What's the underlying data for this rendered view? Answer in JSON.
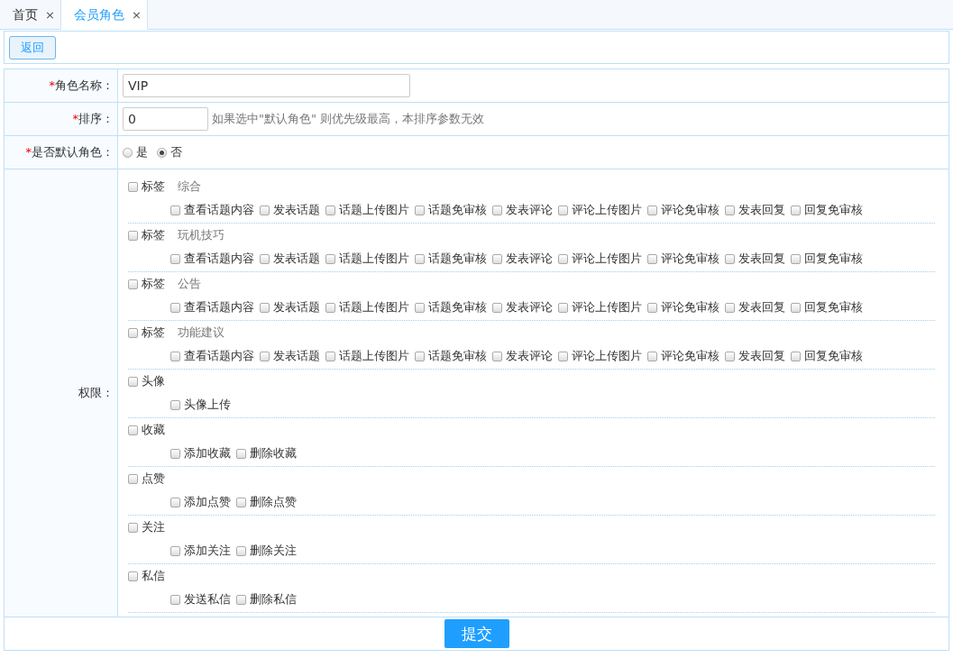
{
  "tabs": [
    {
      "label": "首页",
      "close": "×",
      "selected": false
    },
    {
      "label": "会员角色",
      "close": "×",
      "selected": true
    }
  ],
  "back_button": "返回",
  "fields": [
    {
      "kind": "text",
      "required_mark": "*",
      "label": "角色名称：",
      "value": "VIP",
      "wide": true
    },
    {
      "kind": "text",
      "required_mark": "*",
      "label": "排序：",
      "value": "0",
      "wide": false,
      "hint": "如果选中\"默认角色\" 则优先级最高，本排序参数无效"
    },
    {
      "kind": "radio",
      "required_mark": "*",
      "label": "是否默认角色：",
      "options": [
        {
          "label": "是",
          "selected": false
        },
        {
          "label": "否",
          "selected": true
        }
      ]
    }
  ],
  "permissions": {
    "label": "权限：",
    "groups": [
      {
        "label": "标签",
        "tag": "综合",
        "checked": false,
        "children": [
          {
            "label": "查看话题内容",
            "checked": false
          },
          {
            "label": "发表话题",
            "checked": false
          },
          {
            "label": "话题上传图片",
            "checked": false
          },
          {
            "label": "话题免审核",
            "checked": false
          },
          {
            "label": "发表评论",
            "checked": false
          },
          {
            "label": "评论上传图片",
            "checked": false
          },
          {
            "label": "评论免审核",
            "checked": false
          },
          {
            "label": "发表回复",
            "checked": false
          },
          {
            "label": "回复免审核",
            "checked": false
          }
        ]
      },
      {
        "label": "标签",
        "tag": "玩机技巧",
        "checked": false,
        "children": [
          {
            "label": "查看话题内容",
            "checked": false
          },
          {
            "label": "发表话题",
            "checked": false
          },
          {
            "label": "话题上传图片",
            "checked": false
          },
          {
            "label": "话题免审核",
            "checked": false
          },
          {
            "label": "发表评论",
            "checked": false
          },
          {
            "label": "评论上传图片",
            "checked": false
          },
          {
            "label": "评论免审核",
            "checked": false
          },
          {
            "label": "发表回复",
            "checked": false
          },
          {
            "label": "回复免审核",
            "checked": false
          }
        ]
      },
      {
        "label": "标签",
        "tag": "公告",
        "checked": false,
        "children": [
          {
            "label": "查看话题内容",
            "checked": false
          },
          {
            "label": "发表话题",
            "checked": false
          },
          {
            "label": "话题上传图片",
            "checked": false
          },
          {
            "label": "话题免审核",
            "checked": false
          },
          {
            "label": "发表评论",
            "checked": false
          },
          {
            "label": "评论上传图片",
            "checked": false
          },
          {
            "label": "评论免审核",
            "checked": false
          },
          {
            "label": "发表回复",
            "checked": false
          },
          {
            "label": "回复免审核",
            "checked": false
          }
        ]
      },
      {
        "label": "标签",
        "tag": "功能建议",
        "checked": false,
        "children": [
          {
            "label": "查看话题内容",
            "checked": false
          },
          {
            "label": "发表话题",
            "checked": false
          },
          {
            "label": "话题上传图片",
            "checked": false
          },
          {
            "label": "话题免审核",
            "checked": false
          },
          {
            "label": "发表评论",
            "checked": false
          },
          {
            "label": "评论上传图片",
            "checked": false
          },
          {
            "label": "评论免审核",
            "checked": false
          },
          {
            "label": "发表回复",
            "checked": false
          },
          {
            "label": "回复免审核",
            "checked": false
          }
        ]
      },
      {
        "label": "头像",
        "checked": false,
        "children": [
          {
            "label": "头像上传",
            "checked": false
          }
        ]
      },
      {
        "label": "收藏",
        "checked": false,
        "children": [
          {
            "label": "添加收藏",
            "checked": false
          },
          {
            "label": "删除收藏",
            "checked": false
          }
        ]
      },
      {
        "label": "点赞",
        "checked": false,
        "children": [
          {
            "label": "添加点赞",
            "checked": false
          },
          {
            "label": "删除点赞",
            "checked": false
          }
        ]
      },
      {
        "label": "关注",
        "checked": false,
        "children": [
          {
            "label": "添加关注",
            "checked": false
          },
          {
            "label": "删除关注",
            "checked": false
          }
        ]
      },
      {
        "label": "私信",
        "checked": false,
        "children": [
          {
            "label": "发送私信",
            "checked": false
          },
          {
            "label": "删除私信",
            "checked": false
          }
        ]
      }
    ]
  },
  "submit_button": "提交"
}
